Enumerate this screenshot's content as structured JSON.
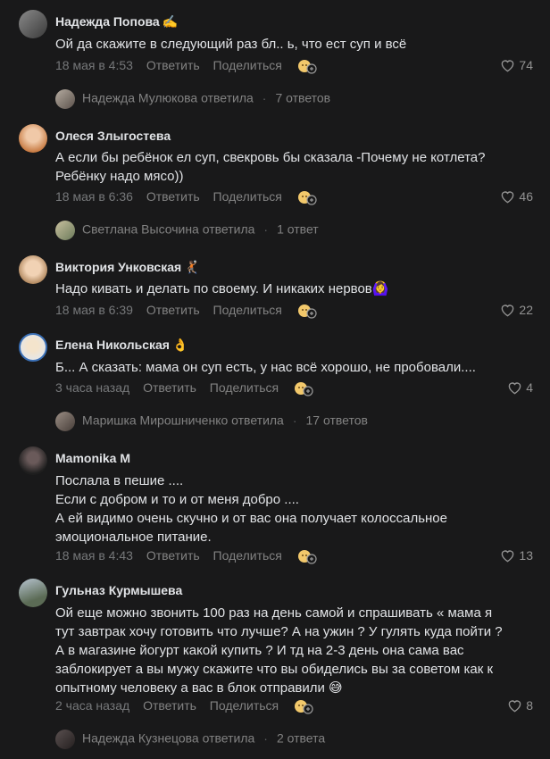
{
  "actions": {
    "reply": "Ответить",
    "share": "Поделиться"
  },
  "comments": [
    {
      "author": "Надежда Попова",
      "emoji": "✍️",
      "text": "Ой да скажите в следующий раз бл.. ь, что ест суп и всё",
      "time": "18 мая в 4:53",
      "likes": "74",
      "thread": {
        "who": "Надежда Мулюкова ответила",
        "count": "7 ответов"
      }
    },
    {
      "author": "Олеся Злыгостева",
      "emoji": "",
      "text": "А если бы ребёнок ел суп, свекровь бы сказала -Почему не котлета?\nРебёнку надо мясо))",
      "time": "18 мая в 6:36",
      "likes": "46",
      "thread": {
        "who": "Светлана Высочина ответила",
        "count": "1 ответ"
      }
    },
    {
      "author": "Виктория Унковская",
      "emoji": "🤾🏽",
      "text": "Надо кивать и делать по своему. И никаких нервов🙆‍♀️",
      "time": "18 мая в 6:39",
      "likes": "22",
      "thread": null
    },
    {
      "author": "Елена Никольская",
      "emoji": "👌",
      "text": "Б... А сказать: мама он суп есть, у нас всё хорошо, не пробовали....",
      "time": "3 часа назад",
      "likes": "4",
      "thread": {
        "who": "Маришка Мирошниченко ответила",
        "count": "17 ответов"
      }
    },
    {
      "author": "Mamonika M",
      "emoji": "",
      "text": "Послала в пешие ....\nЕсли с добром и то и от меня добро ....\nА ей видимо очень скучно и от вас она получает колоссальное\nэмоциональное питание.",
      "time": "18 мая в 4:43",
      "likes": "13",
      "thread": null
    },
    {
      "author": "Гульназ Курмышева",
      "emoji": "",
      "text": "Ой еще можно звонить 100 раз на день самой и спрашивать « мама я\nтут завтрак хочу готовить что лучше? А на ужин ? У гулять куда пойти ?\nА в магазине йогурт какой купить ? И тд на 2-3 день она сама вас\nзаблокирует а вы мужу скажите что вы обиделись вы за советом как к\nопытному человеку а вас в блок отправили 😅",
      "time": "2 часа назад",
      "likes": "8",
      "thread": {
        "who": "Надежда Кузнецова ответила",
        "count": "2 ответа"
      }
    }
  ],
  "colors": {
    "background": "#19191a",
    "text": "#e1e3e6",
    "secondary": "#828282",
    "meta": "#76787a"
  }
}
